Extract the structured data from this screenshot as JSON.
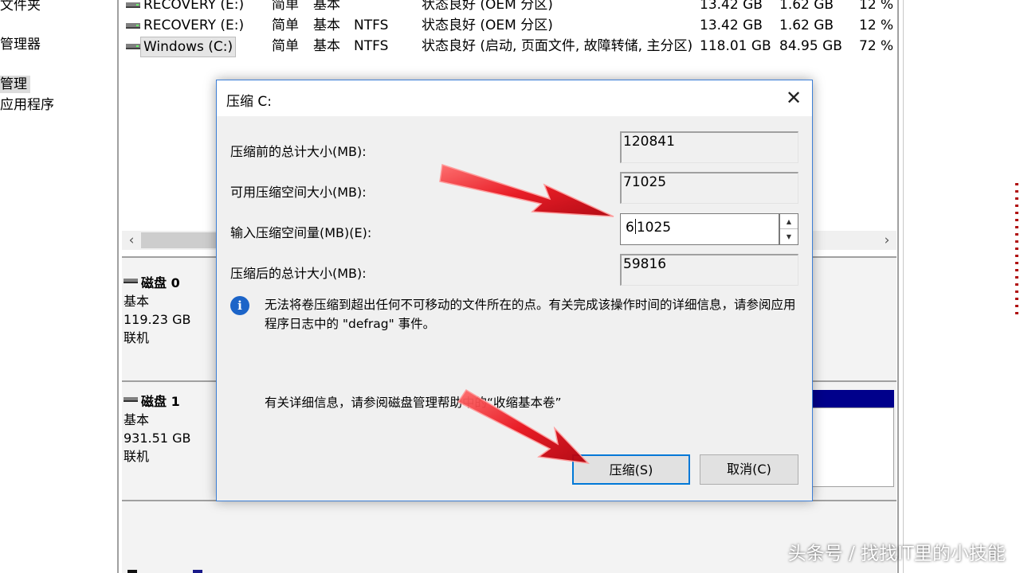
{
  "nav": {
    "items": [
      {
        "label": "文件夹"
      },
      {
        "label": "管理器"
      },
      {
        "label": "管理",
        "selected": true
      },
      {
        "label": "应用程序"
      }
    ]
  },
  "volumes": {
    "rows": [
      {
        "name": "RECOVERY (E:)",
        "layout": "简单",
        "type": "基本",
        "fs": "",
        "status": "状态良好 (OEM 分区)",
        "capacity": "13.42 GB",
        "free": "1.62 GB",
        "pct": "12 %"
      },
      {
        "name": "RECOVERY (E:)",
        "layout": "简单",
        "type": "基本",
        "fs": "NTFS",
        "status": "状态良好 (OEM 分区)",
        "capacity": "13.42 GB",
        "free": "1.62 GB",
        "pct": "12 %"
      },
      {
        "name": "Windows (C:)",
        "layout": "简单",
        "type": "基本",
        "fs": "NTFS",
        "status": "状态良好 (启动, 页面文件, 故障转储, 主分区)",
        "capacity": "118.01 GB",
        "free": "84.95 GB",
        "pct": "72 %"
      }
    ]
  },
  "scroll": {
    "left": "‹",
    "right": "›"
  },
  "disks": [
    {
      "title": "磁盘 0",
      "type": "基本",
      "size": "119.23 GB",
      "state": "联机"
    },
    {
      "title": "磁盘 1",
      "type": "基本",
      "size": "931.51 GB",
      "state": "联机"
    }
  ],
  "dialog": {
    "title": "压缩 C:",
    "close": "✕",
    "fields": {
      "total_before_label": "压缩前的总计大小(MB):",
      "total_before_value": "120841",
      "available_label": "可用压缩空间大小(MB):",
      "available_value": "71025",
      "input_label": "输入压缩空间量(MB)(E):",
      "input_value_prefix": "6",
      "input_value_suffix": "1025",
      "total_after_label": "压缩后的总计大小(MB):",
      "total_after_value": "59816"
    },
    "info": "无法将卷压缩到超出任何不可移动的文件所在的点。有关完成该操作时间的详细信息，请参阅应用程序日志中的 \"defrag\" 事件。",
    "help": "有关详细信息，请参阅磁盘管理帮助中的“收缩基本卷”",
    "buttons": {
      "shrink": "压缩(S)",
      "cancel": "取消(C)"
    }
  },
  "watermark": "头条号 / 找找IT里的小技能",
  "colors": {
    "accent": "#0078d7",
    "partition_primary": "#00008b",
    "arrow": "#e8121c"
  }
}
